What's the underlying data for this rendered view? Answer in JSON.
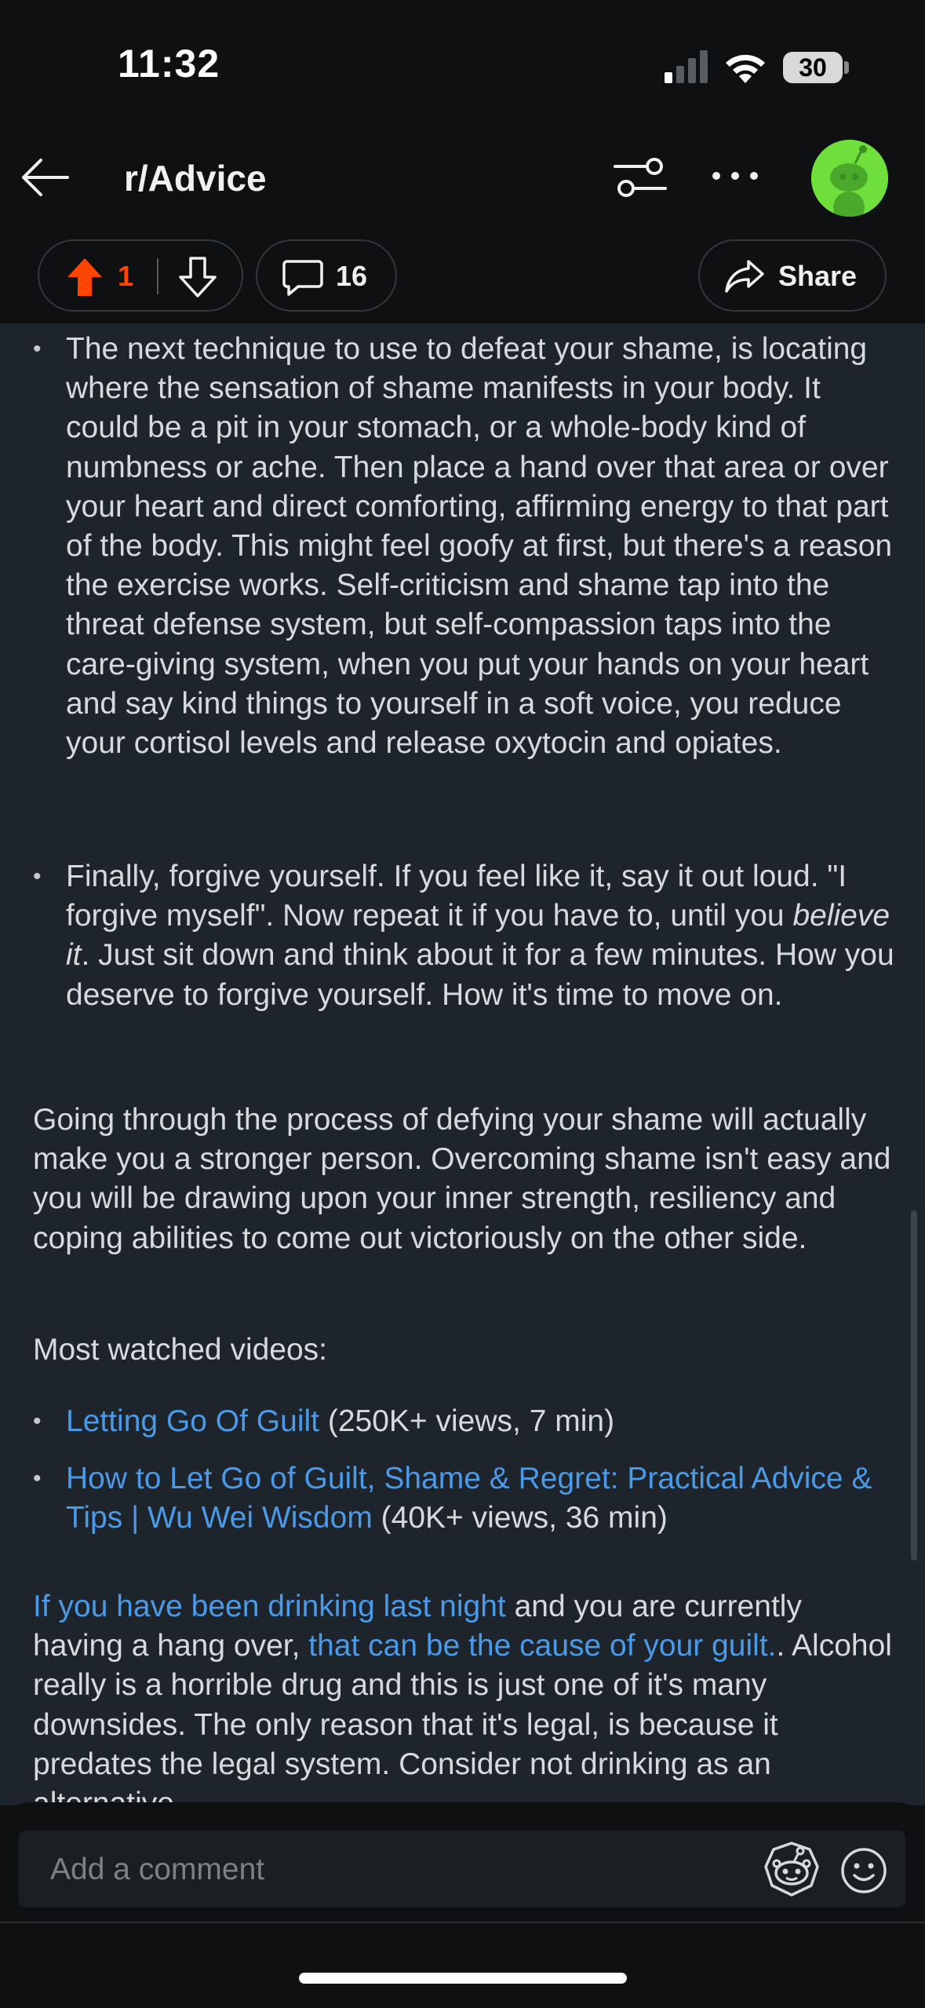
{
  "status_bar": {
    "time": "11:32",
    "battery": "30",
    "icons": [
      "signal-icon",
      "wifi-icon",
      "battery-icon"
    ]
  },
  "nav": {
    "title": "r/Advice",
    "icons": [
      "back-arrow-icon",
      "filter-icon",
      "more-icon",
      "avatar"
    ]
  },
  "actions": {
    "upvotes": "1",
    "comments": "16",
    "share_label": "Share",
    "upvote_color": "#ff4500"
  },
  "post": {
    "bullet1": "The next technique to use to defeat your shame, is locating where the sensation of shame manifests in your body. It could be a pit in your stomach, or a whole-body kind of numbness or ache. Then place a hand over that area or over your heart and direct comforting, affirming energy to that part of the body. This might feel goofy at first, but there's a reason the exercise works. Self-criticism and shame tap into the threat defense system, but self-compassion taps into the care-giving system, when you put your hands on your heart and say kind things to yourself in a soft voice, you reduce your cortisol levels and release oxytocin and opiates.",
    "bullet2_a": "Finally, forgive yourself. If you feel like it, say it out loud. \"I forgive myself\". Now repeat it if you have to, until you ",
    "bullet2_em": "believe it",
    "bullet2_b": ". Just sit down and think about it for a few minutes. How you deserve to forgive yourself. How it's time to move on.",
    "para1": "Going through the process of defying your shame will actually make you a stronger person. Overcoming shame isn't easy and you will be drawing upon your inner strength, resiliency and coping abilities to come out victoriously on the other side.",
    "videos_heading": "Most watched videos:",
    "video1_link": "Letting Go Of Guilt",
    "video1_meta": " (250K+ views, 7 min)",
    "video2_link": "How to Let Go of Guilt, Shame & Regret: Practical Advice & Tips | Wu Wei Wisdom",
    "video2_meta": " (40K+ views, 36 min)",
    "para2_link1": "If you have been drinking last night",
    "para2_text1": " and you are currently having a hang over, ",
    "para2_link2": "that can be the cause of your guilt.",
    "para2_text2": ". Alcohol really is a horrible drug and this is just one of it's many downsides. The only reason that it's legal, is because it predates the legal system. Consider not drinking as an alternative."
  },
  "comment_bar": {
    "placeholder": "Add a comment"
  },
  "colors": {
    "link": "#4a9ae8",
    "content_bg": "#1e242c",
    "chrome_bg": "#0e1012",
    "avatar_bg": "#6fe03b"
  }
}
